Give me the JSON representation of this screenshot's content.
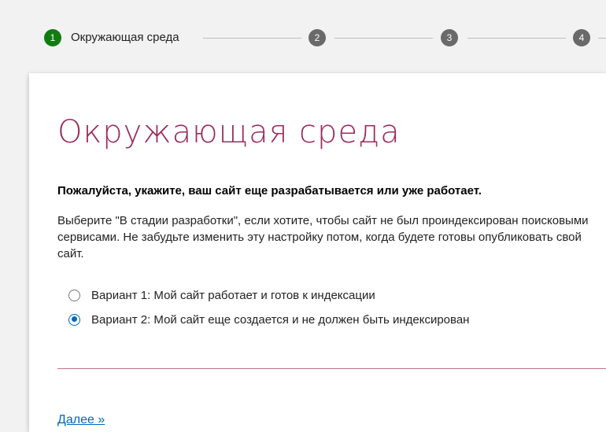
{
  "stepper": {
    "steps": [
      {
        "number": "1",
        "label": "Окружающая среда",
        "state": "active"
      },
      {
        "number": "2",
        "state": "inactive"
      },
      {
        "number": "3",
        "state": "inactive"
      },
      {
        "number": "4",
        "state": "inactive"
      }
    ],
    "colors": {
      "active": "#107c10",
      "inactive": "#6a6a6a"
    }
  },
  "main": {
    "title": "Окружающая среда",
    "prompt": "Пожалуйста, укажите, ваш сайт еще разрабатывается или уже работает.",
    "description": "Выберите \"В стадии разработки\", если хотите, чтобы сайт не был проиндексирован поисковыми сервисами. Не забудьте изменить эту настройку потом, когда будете готовы опубликовать свой сайт.",
    "options": [
      {
        "label": "Вариант 1: Мой сайт работает и готов к индексации",
        "selected": false
      },
      {
        "label": "Вариант 2: Мой сайт еще создается и не должен быть индексирован",
        "selected": true
      }
    ],
    "next_label": "Далее »"
  },
  "colors": {
    "title": "#9b2c5e",
    "link": "#0067b8",
    "divider": "#c0718f",
    "radio_selected": "#0067c0"
  }
}
